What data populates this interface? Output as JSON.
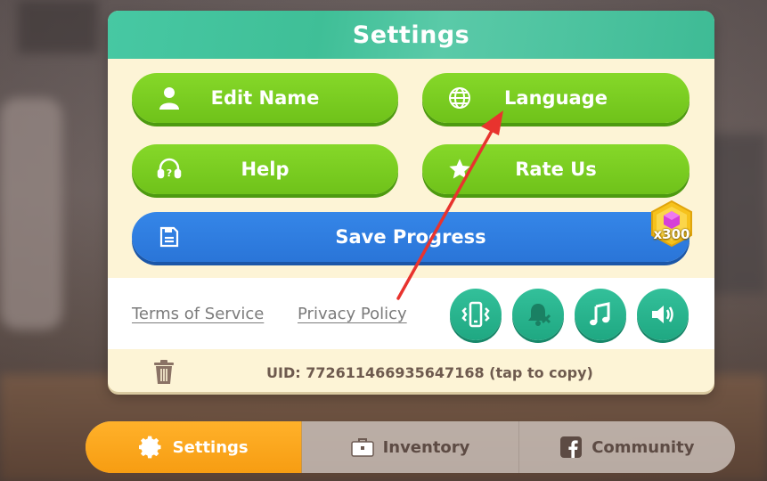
{
  "panel": {
    "title": "Settings",
    "buttons": {
      "edit_name": "Edit Name",
      "language": "Language",
      "help": "Help",
      "rate_us": "Rate Us",
      "save_progress": "Save Progress"
    },
    "reward_badge": {
      "text": "x300",
      "icon": "gem-icon"
    },
    "links": {
      "terms": "Terms of Service",
      "privacy": "Privacy Policy"
    },
    "toggles": [
      "vibration-icon",
      "notifications-muted-icon",
      "music-icon",
      "sound-icon"
    ],
    "uid": "UID: 772611466935647168 (tap to copy)"
  },
  "nav": {
    "tabs": [
      {
        "label": "Settings",
        "icon": "gear-icon",
        "active": true
      },
      {
        "label": "Inventory",
        "icon": "briefcase-icon",
        "active": false
      },
      {
        "label": "Community",
        "icon": "facebook-icon",
        "active": false
      }
    ]
  },
  "colors": {
    "header": "#47c8a3",
    "green_button": "#78cc22",
    "blue_button": "#2f7ee0",
    "teal_round": "#2bb590",
    "active_tab": "#f9a41b",
    "annotation_arrow": "#e8332e"
  }
}
